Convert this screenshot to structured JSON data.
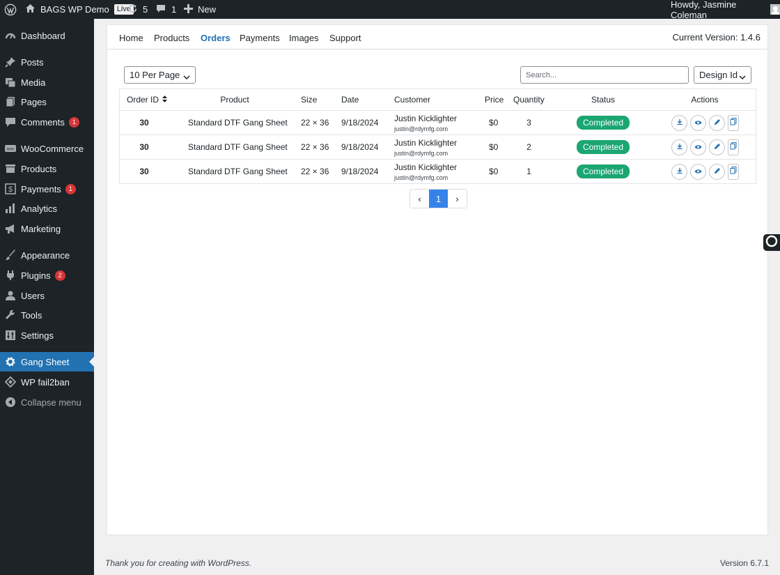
{
  "adminbar": {
    "site_name": "BAGS WP Demo",
    "live_label": "Live",
    "updates_count": "5",
    "comments_count": "1",
    "new_label": "New",
    "greeting": "Howdy, Jasmine Coleman"
  },
  "sidebar": {
    "items": [
      {
        "label": "Dashboard",
        "icon": "dashboard-icon"
      },
      {
        "label": "Posts",
        "icon": "pin-icon"
      },
      {
        "label": "Media",
        "icon": "media-icon"
      },
      {
        "label": "Pages",
        "icon": "pages-icon"
      },
      {
        "label": "Comments",
        "icon": "comment-icon",
        "badge": "1"
      },
      {
        "label": "WooCommerce",
        "icon": "woo-icon"
      },
      {
        "label": "Products",
        "icon": "archive-icon"
      },
      {
        "label": "Payments",
        "icon": "dollar-icon",
        "badge": "1"
      },
      {
        "label": "Analytics",
        "icon": "chart-icon"
      },
      {
        "label": "Marketing",
        "icon": "megaphone-icon"
      },
      {
        "label": "Appearance",
        "icon": "brush-icon"
      },
      {
        "label": "Plugins",
        "icon": "plug-icon",
        "badge": "2"
      },
      {
        "label": "Users",
        "icon": "user-icon"
      },
      {
        "label": "Tools",
        "icon": "wrench-icon"
      },
      {
        "label": "Settings",
        "icon": "sliders-icon"
      },
      {
        "label": "Gang Sheet",
        "icon": "gear-icon",
        "current": true
      },
      {
        "label": "WP fail2ban",
        "icon": "fail2ban-icon"
      },
      {
        "label": "Collapse menu",
        "icon": "collapse-icon"
      }
    ]
  },
  "tabs": {
    "home": "Home",
    "products": "Products",
    "orders": "Orders",
    "payments": "Payments",
    "images": "Images",
    "support": "Support",
    "active": "Orders",
    "version": "Current Version: 1.4.6"
  },
  "controls": {
    "per_page": "10 Per Page",
    "search_placeholder": "Search...",
    "sort_field": "Design Id"
  },
  "table": {
    "headers": {
      "order_id": "Order ID",
      "product": "Product",
      "size": "Size",
      "date": "Date",
      "customer": "Customer",
      "price": "Price",
      "quantity": "Quantity",
      "status": "Status",
      "actions": "Actions"
    },
    "rows": [
      {
        "order_id": "30",
        "product": "Standard DTF Gang Sheet",
        "size": "22 × 36",
        "date": "9/18/2024",
        "customer": "Justin Kicklighter",
        "email": "justin@rdymfg.com",
        "price": "$0",
        "quantity": "3",
        "status": "Completed"
      },
      {
        "order_id": "30",
        "product": "Standard DTF Gang Sheet",
        "size": "22 × 36",
        "date": "9/18/2024",
        "customer": "Justin Kicklighter",
        "email": "justin@rdymfg.com",
        "price": "$0",
        "quantity": "2",
        "status": "Completed"
      },
      {
        "order_id": "30",
        "product": "Standard DTF Gang Sheet",
        "size": "22 × 36",
        "date": "9/18/2024",
        "customer": "Justin Kicklighter",
        "email": "justin@rdymfg.com",
        "price": "$0",
        "quantity": "1",
        "status": "Completed"
      }
    ]
  },
  "pagination": {
    "prev": "‹",
    "current": "1",
    "next": "›"
  },
  "footer": {
    "thanks": "Thank you for creating with WordPress.",
    "version": "Version 6.7.1"
  },
  "colors": {
    "accent": "#2271b1",
    "status_completed": "#1ba672",
    "admin_dark": "#1d2327"
  }
}
